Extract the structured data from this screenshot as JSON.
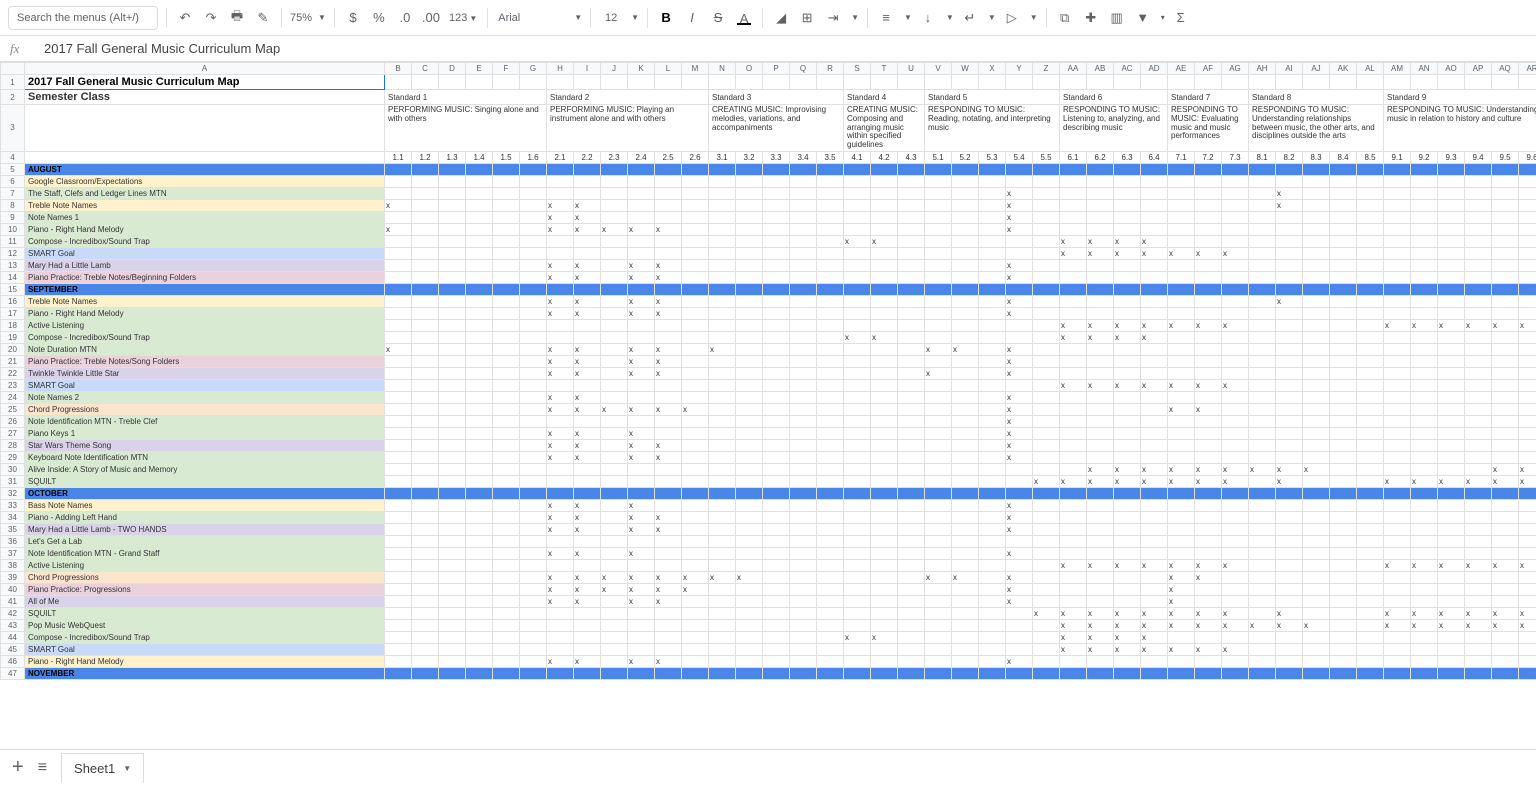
{
  "toolbar": {
    "search_placeholder": "Search the menus (Alt+/)",
    "zoom": "75%",
    "format123": "123",
    "font": "Arial",
    "fontsize": "12",
    "bold": "B",
    "italic": "I",
    "strike": "S",
    "textcolor": "A"
  },
  "fx": {
    "label": "fx",
    "value": "2017 Fall General Music Curriculum Map"
  },
  "colLetters": [
    "A",
    "B",
    "C",
    "D",
    "E",
    "F",
    "G",
    "H",
    "I",
    "J",
    "K",
    "L",
    "M",
    "N",
    "O",
    "P",
    "Q",
    "R",
    "S",
    "T",
    "U",
    "V",
    "W",
    "X",
    "Y",
    "Z",
    "AA",
    "AB",
    "AC",
    "AD",
    "AE",
    "AF",
    "AG",
    "AH",
    "AI",
    "AJ",
    "AK",
    "AL",
    "AM",
    "AN",
    "AO",
    "AP",
    "AQ",
    "AR"
  ],
  "row1": {
    "A": "2017 Fall General Music Curriculum Map"
  },
  "row2": {
    "A": "Semester Class",
    "stds": [
      "Standard 1",
      "Standard 2",
      "Standard 3",
      "Standard 4",
      "Standard 5",
      "Standard 6",
      "Standard 7",
      "Standard 8",
      "Standard 9"
    ]
  },
  "row3": {
    "descs": [
      "PERFORMING MUSIC: Singing alone and with others",
      "PERFORMING MUSIC: Playing an instrument alone and with others",
      "CREATING MUSIC: Improvising melodies, variations, and accompaniments",
      "CREATING MUSIC: Composing and arranging music within specified guidelines",
      "RESPONDING TO MUSIC: Reading, notating, and interpreting music",
      "RESPONDING TO MUSIC: Listening to, analyzing, and describing music",
      "RESPONDING TO MUSIC: Evaluating music and music performances",
      "RESPONDING TO MUSIC: Understanding relationships between music, the other arts, and disciplines outside the arts",
      "RESPONDING TO MUSIC: Understanding music in relation to history and culture"
    ]
  },
  "row4": {
    "subs": [
      "1.1",
      "1.2",
      "1.3",
      "1.4",
      "1.5",
      "1.6",
      "2.1",
      "2.2",
      "2.3",
      "2.4",
      "2.5",
      "2.6",
      "3.1",
      "3.2",
      "3.3",
      "3.4",
      "3.5",
      "4.1",
      "4.2",
      "4.3",
      "5.1",
      "5.2",
      "5.3",
      "5.4",
      "5.5",
      "6.1",
      "6.2",
      "6.3",
      "6.4",
      "7.1",
      "7.2",
      "7.3",
      "8.1",
      "8.2",
      "8.3",
      "8.4",
      "8.5",
      "9.1",
      "9.2",
      "9.3",
      "9.4",
      "9.5",
      "9.6"
    ]
  },
  "rows": [
    {
      "n": 5,
      "label": "AUGUST",
      "cls": "month",
      "marks": []
    },
    {
      "n": 6,
      "label": "Google Classroom/Expectations",
      "cls": "c-yellow",
      "marks": []
    },
    {
      "n": 7,
      "label": "The Staff, Clefs and Ledger Lines  MTN",
      "cls": "c-green",
      "marks": [
        23,
        33
      ]
    },
    {
      "n": 8,
      "label": "Treble Note Names",
      "cls": "c-yellow",
      "marks": [
        0,
        6,
        7,
        23,
        33
      ]
    },
    {
      "n": 9,
      "label": "Note Names 1",
      "cls": "c-green",
      "marks": [
        6,
        7,
        23
      ]
    },
    {
      "n": 10,
      "label": "Piano - Right Hand Melody",
      "cls": "c-green",
      "marks": [
        0,
        6,
        7,
        8,
        9,
        10,
        23
      ]
    },
    {
      "n": 11,
      "label": "Compose - Incredibox/Sound Trap",
      "cls": "c-green",
      "marks": [
        17,
        18,
        25,
        26,
        27,
        28
      ]
    },
    {
      "n": 12,
      "label": "SMART Goal",
      "cls": "c-blue",
      "marks": [
        25,
        26,
        27,
        28,
        29,
        30,
        31
      ]
    },
    {
      "n": 13,
      "label": "Mary Had a Little Lamb",
      "cls": "c-purple",
      "marks": [
        6,
        7,
        9,
        10,
        23
      ]
    },
    {
      "n": 14,
      "label": "Piano Practice: Treble Notes/Beginning Folders",
      "cls": "c-pink",
      "marks": [
        6,
        7,
        9,
        10,
        23
      ]
    },
    {
      "n": 15,
      "label": "SEPTEMBER",
      "cls": "month",
      "marks": []
    },
    {
      "n": 16,
      "label": "Treble Note Names",
      "cls": "c-yellow",
      "marks": [
        6,
        7,
        9,
        10,
        23,
        33
      ]
    },
    {
      "n": 17,
      "label": "Piano - Right Hand Melody",
      "cls": "c-green",
      "marks": [
        6,
        7,
        9,
        10,
        23
      ]
    },
    {
      "n": 18,
      "label": "Active Listening",
      "cls": "c-green",
      "marks": [
        25,
        26,
        27,
        28,
        29,
        30,
        31,
        37,
        38,
        39,
        40,
        41,
        42
      ]
    },
    {
      "n": 19,
      "label": "Compose - Incredibox/Sound Trap",
      "cls": "c-green",
      "marks": [
        17,
        18,
        25,
        26,
        27,
        28
      ]
    },
    {
      "n": 20,
      "label": "Note Duration MTN",
      "cls": "c-green",
      "marks": [
        0,
        6,
        7,
        9,
        10,
        12,
        20,
        21,
        23
      ]
    },
    {
      "n": 21,
      "label": "Piano Practice: Treble Notes/Song Folders",
      "cls": "c-pink",
      "marks": [
        6,
        7,
        9,
        10,
        23
      ]
    },
    {
      "n": 22,
      "label": "Twinkle Twinkle Little Star",
      "cls": "c-purple",
      "marks": [
        6,
        7,
        9,
        10,
        20,
        23
      ]
    },
    {
      "n": 23,
      "label": "SMART Goal",
      "cls": "c-blue",
      "marks": [
        25,
        26,
        27,
        28,
        29,
        30,
        31
      ]
    },
    {
      "n": 24,
      "label": "Note Names 2",
      "cls": "c-green",
      "marks": [
        6,
        7,
        23
      ]
    },
    {
      "n": 25,
      "label": "Chord Progressions",
      "cls": "c-orange",
      "marks": [
        6,
        7,
        8,
        9,
        10,
        11,
        23,
        29,
        30
      ]
    },
    {
      "n": 26,
      "label": "Note Identification  MTN - Treble Clef",
      "cls": "c-green",
      "marks": [
        23
      ]
    },
    {
      "n": 27,
      "label": "Piano Keys 1",
      "cls": "c-green",
      "marks": [
        6,
        7,
        9,
        23
      ]
    },
    {
      "n": 28,
      "label": "Star Wars Theme Song",
      "cls": "c-purple",
      "marks": [
        6,
        7,
        9,
        10,
        23
      ]
    },
    {
      "n": 29,
      "label": "Keyboard Note Identification MTN",
      "cls": "c-green",
      "marks": [
        6,
        7,
        9,
        10,
        23
      ]
    },
    {
      "n": 30,
      "label": "Alive Inside: A Story of Music and Memory",
      "cls": "c-green",
      "marks": [
        26,
        27,
        28,
        29,
        30,
        31,
        32,
        33,
        34,
        41,
        42
      ]
    },
    {
      "n": 31,
      "label": "SQUILT",
      "cls": "c-green",
      "marks": [
        24,
        25,
        26,
        27,
        28,
        29,
        30,
        31,
        33,
        37,
        38,
        39,
        40,
        41,
        42
      ]
    },
    {
      "n": 32,
      "label": "OCTOBER",
      "cls": "month",
      "marks": []
    },
    {
      "n": 33,
      "label": "Bass Note Names",
      "cls": "c-yellow",
      "marks": [
        6,
        7,
        9,
        23
      ]
    },
    {
      "n": 34,
      "label": "Piano - Adding Left Hand",
      "cls": "c-green",
      "marks": [
        6,
        7,
        9,
        10,
        23
      ]
    },
    {
      "n": 35,
      "label": "Mary Had a Little Lamb - TWO HANDS",
      "cls": "c-purple",
      "marks": [
        6,
        7,
        9,
        10,
        23
      ]
    },
    {
      "n": 36,
      "label": "Let's Get a Lab",
      "cls": "c-green",
      "marks": []
    },
    {
      "n": 37,
      "label": "Note Identification  MTN - Grand Staff",
      "cls": "c-green",
      "marks": [
        6,
        7,
        9,
        23
      ]
    },
    {
      "n": 38,
      "label": "Active Listening",
      "cls": "c-green",
      "marks": [
        25,
        26,
        27,
        28,
        29,
        30,
        31,
        37,
        38,
        39,
        40,
        41,
        42
      ]
    },
    {
      "n": 39,
      "label": "Chord Progressions",
      "cls": "c-orange",
      "marks": [
        6,
        7,
        8,
        9,
        10,
        11,
        12,
        13,
        20,
        21,
        23,
        29,
        30
      ]
    },
    {
      "n": 40,
      "label": "Piano Practice: Progressions",
      "cls": "c-pink",
      "marks": [
        6,
        7,
        8,
        9,
        10,
        11,
        23,
        29
      ]
    },
    {
      "n": 41,
      "label": "All of Me",
      "cls": "c-purple",
      "marks": [
        6,
        7,
        9,
        10,
        23,
        29
      ]
    },
    {
      "n": 42,
      "label": "SQUILT",
      "cls": "c-green",
      "marks": [
        24,
        25,
        26,
        27,
        28,
        29,
        30,
        31,
        33,
        37,
        38,
        39,
        40,
        41,
        42
      ]
    },
    {
      "n": 43,
      "label": "Pop Music WebQuest",
      "cls": "c-green",
      "marks": [
        25,
        26,
        27,
        28,
        29,
        30,
        31,
        32,
        33,
        34,
        37,
        38,
        39,
        40,
        41,
        42
      ]
    },
    {
      "n": 44,
      "label": "Compose - Incredibox/Sound Trap",
      "cls": "c-green",
      "marks": [
        17,
        18,
        25,
        26,
        27,
        28
      ]
    },
    {
      "n": 45,
      "label": "SMART Goal",
      "cls": "c-blue",
      "marks": [
        25,
        26,
        27,
        28,
        29,
        30,
        31
      ]
    },
    {
      "n": 46,
      "label": "Piano - Right Hand Melody",
      "cls": "c-yellow",
      "marks": [
        6,
        7,
        9,
        10,
        23
      ]
    },
    {
      "n": 47,
      "label": "NOVEMBER",
      "cls": "month",
      "marks": []
    }
  ],
  "footer": {
    "sheet": "Sheet1"
  },
  "stdCols": [
    6,
    6,
    5,
    3,
    5,
    4,
    3,
    5,
    6
  ]
}
